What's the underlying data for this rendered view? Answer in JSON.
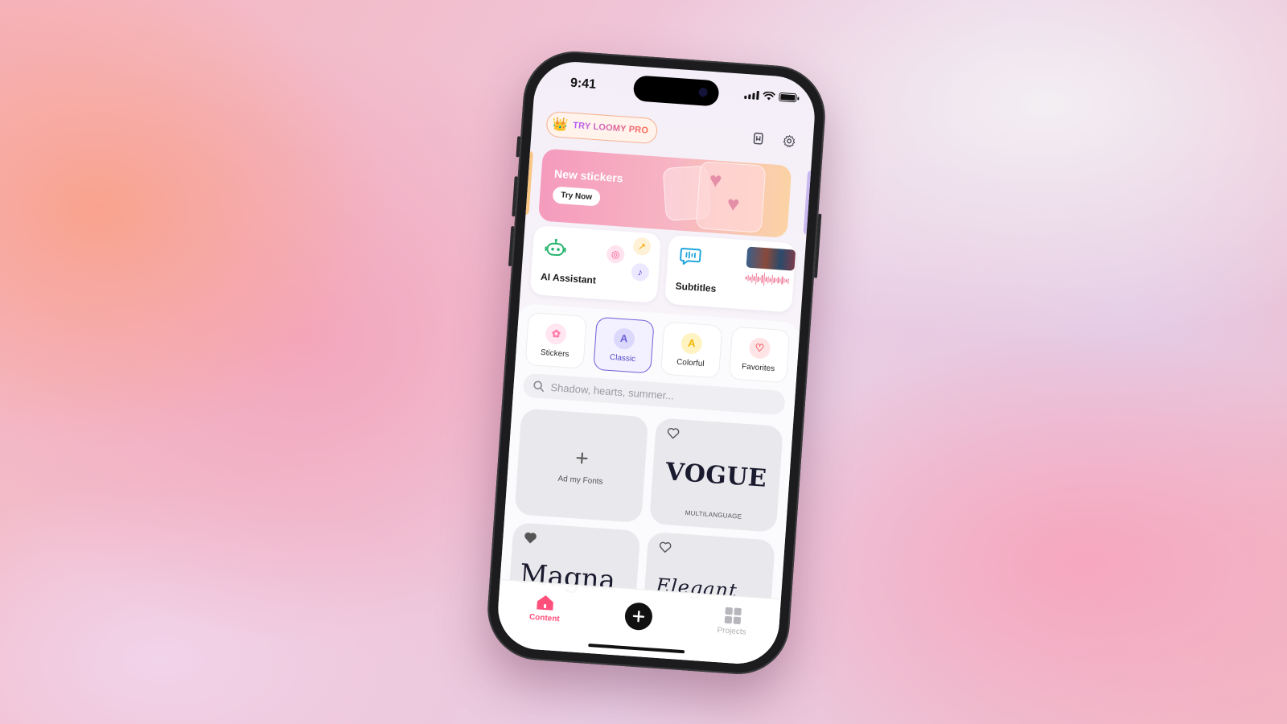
{
  "status_bar": {
    "time": "9:41"
  },
  "header": {
    "pro_label": "TRY LOOMY PRO",
    "icons": [
      "crown-icon",
      "bookmark-icon",
      "gear-icon"
    ]
  },
  "banner": {
    "title": "New stickers",
    "button_label": "Try Now"
  },
  "features": [
    {
      "label": "AI Assistant",
      "icon": "robot-icon"
    },
    {
      "label": "Subtitles",
      "icon": "speech-bubble-icon"
    }
  ],
  "categories": [
    {
      "label": "Stickers",
      "icon": "sticker-icon",
      "color": "#ff7aa8",
      "active": false
    },
    {
      "label": "Classic",
      "icon": "letter-a-icon",
      "color": "#6b5ed8",
      "active": true
    },
    {
      "label": "Colorful",
      "icon": "letter-a-icon",
      "color": "#f4b400",
      "active": false
    },
    {
      "label": "Favorites",
      "icon": "heart-icon",
      "color": "#f0505a",
      "active": false
    }
  ],
  "search": {
    "placeholder": "Shadow, hearts, summer..."
  },
  "fonts": {
    "add_label": "Ad my Fonts",
    "items": [
      {
        "sample": "VOGUE",
        "caption": "MULTILANGUAGE",
        "favorited": false
      },
      {
        "sample": "Magna",
        "caption": "",
        "favorited": true
      },
      {
        "sample": "Elegant",
        "caption": "",
        "favorited": false
      }
    ]
  },
  "tabbar": {
    "content_label": "Content",
    "projects_label": "Projects",
    "accent": "#ff4f7b"
  },
  "colors": {
    "accent_purple": "#6b5ed8",
    "banner_start": "#f59bbd",
    "banner_end": "#fbd3a5"
  }
}
